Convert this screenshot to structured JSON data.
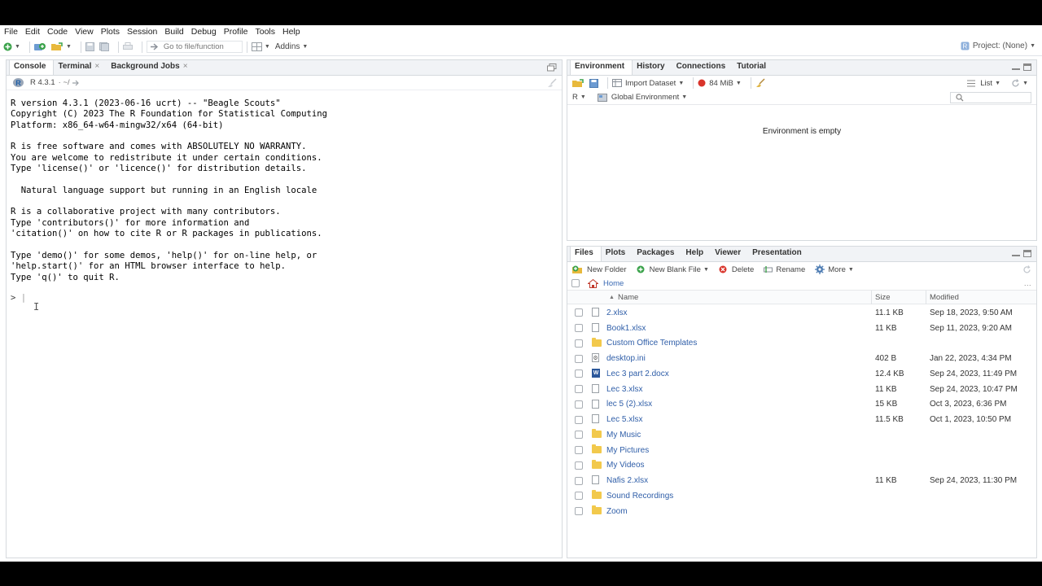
{
  "menu": [
    "File",
    "Edit",
    "Code",
    "View",
    "Plots",
    "Session",
    "Build",
    "Debug",
    "Profile",
    "Tools",
    "Help"
  ],
  "toolbar": {
    "goto_placeholder": "Go to file/function",
    "addins": "Addins",
    "project": "Project: (None)"
  },
  "console_pane": {
    "tabs": [
      "Console",
      "Terminal",
      "Background Jobs"
    ],
    "r_version": "R 4.3.1",
    "path": "· ~/",
    "output": "R version 4.3.1 (2023-06-16 ucrt) -- \"Beagle Scouts\"\nCopyright (C) 2023 The R Foundation for Statistical Computing\nPlatform: x86_64-w64-mingw32/x64 (64-bit)\n\nR is free software and comes with ABSOLUTELY NO WARRANTY.\nYou are welcome to redistribute it under certain conditions.\nType 'license()' or 'licence()' for distribution details.\n\n  Natural language support but running in an English locale\n\nR is a collaborative project with many contributors.\nType 'contributors()' for more information and\n'citation()' on how to cite R or R packages in publications.\n\nType 'demo()' for some demos, 'help()' for on-line help, or\n'help.start()' for an HTML browser interface to help.\nType 'q()' to quit R.",
    "prompt": ">"
  },
  "env_pane": {
    "tabs": [
      "Environment",
      "History",
      "Connections",
      "Tutorial"
    ],
    "import_dataset": "Import Dataset",
    "memory": "84 MiB",
    "view_mode": "List",
    "language": "R",
    "scope": "Global Environment",
    "empty_message": "Environment is empty"
  },
  "files_pane": {
    "tabs": [
      "Files",
      "Plots",
      "Packages",
      "Help",
      "Viewer",
      "Presentation"
    ],
    "new_folder": "New Folder",
    "new_blank_file": "New Blank File",
    "delete": "Delete",
    "rename": "Rename",
    "more": "More",
    "breadcrumb": "Home",
    "columns": {
      "name": "Name",
      "size": "Size",
      "modified": "Modified"
    },
    "files": [
      {
        "name": "2.xlsx",
        "size": "11.1 KB",
        "modified": "Sep 18, 2023, 9:50 AM",
        "icon": "file"
      },
      {
        "name": "Book1.xlsx",
        "size": "11 KB",
        "modified": "Sep 11, 2023, 9:20 AM",
        "icon": "file"
      },
      {
        "name": "Custom Office Templates",
        "size": "",
        "modified": "",
        "icon": "folder"
      },
      {
        "name": "desktop.ini",
        "size": "402 B",
        "modified": "Jan 22, 2023, 4:34 PM",
        "icon": "ini"
      },
      {
        "name": "Lec 3 part 2.docx",
        "size": "12.4 KB",
        "modified": "Sep 24, 2023, 11:49 PM",
        "icon": "word"
      },
      {
        "name": "Lec 3.xlsx",
        "size": "11 KB",
        "modified": "Sep 24, 2023, 10:47 PM",
        "icon": "file"
      },
      {
        "name": "lec 5 (2).xlsx",
        "size": "15 KB",
        "modified": "Oct 3, 2023, 6:36 PM",
        "icon": "file"
      },
      {
        "name": "Lec 5.xlsx",
        "size": "11.5 KB",
        "modified": "Oct 1, 2023, 10:50 PM",
        "icon": "file"
      },
      {
        "name": "My Music",
        "size": "",
        "modified": "",
        "icon": "folder"
      },
      {
        "name": "My Pictures",
        "size": "",
        "modified": "",
        "icon": "folder"
      },
      {
        "name": "My Videos",
        "size": "",
        "modified": "",
        "icon": "folder"
      },
      {
        "name": "Nafis 2.xlsx",
        "size": "11 KB",
        "modified": "Sep 24, 2023, 11:30 PM",
        "icon": "file"
      },
      {
        "name": "Sound Recordings",
        "size": "",
        "modified": "",
        "icon": "folder"
      },
      {
        "name": "Zoom",
        "size": "",
        "modified": "",
        "icon": "folder"
      }
    ]
  }
}
